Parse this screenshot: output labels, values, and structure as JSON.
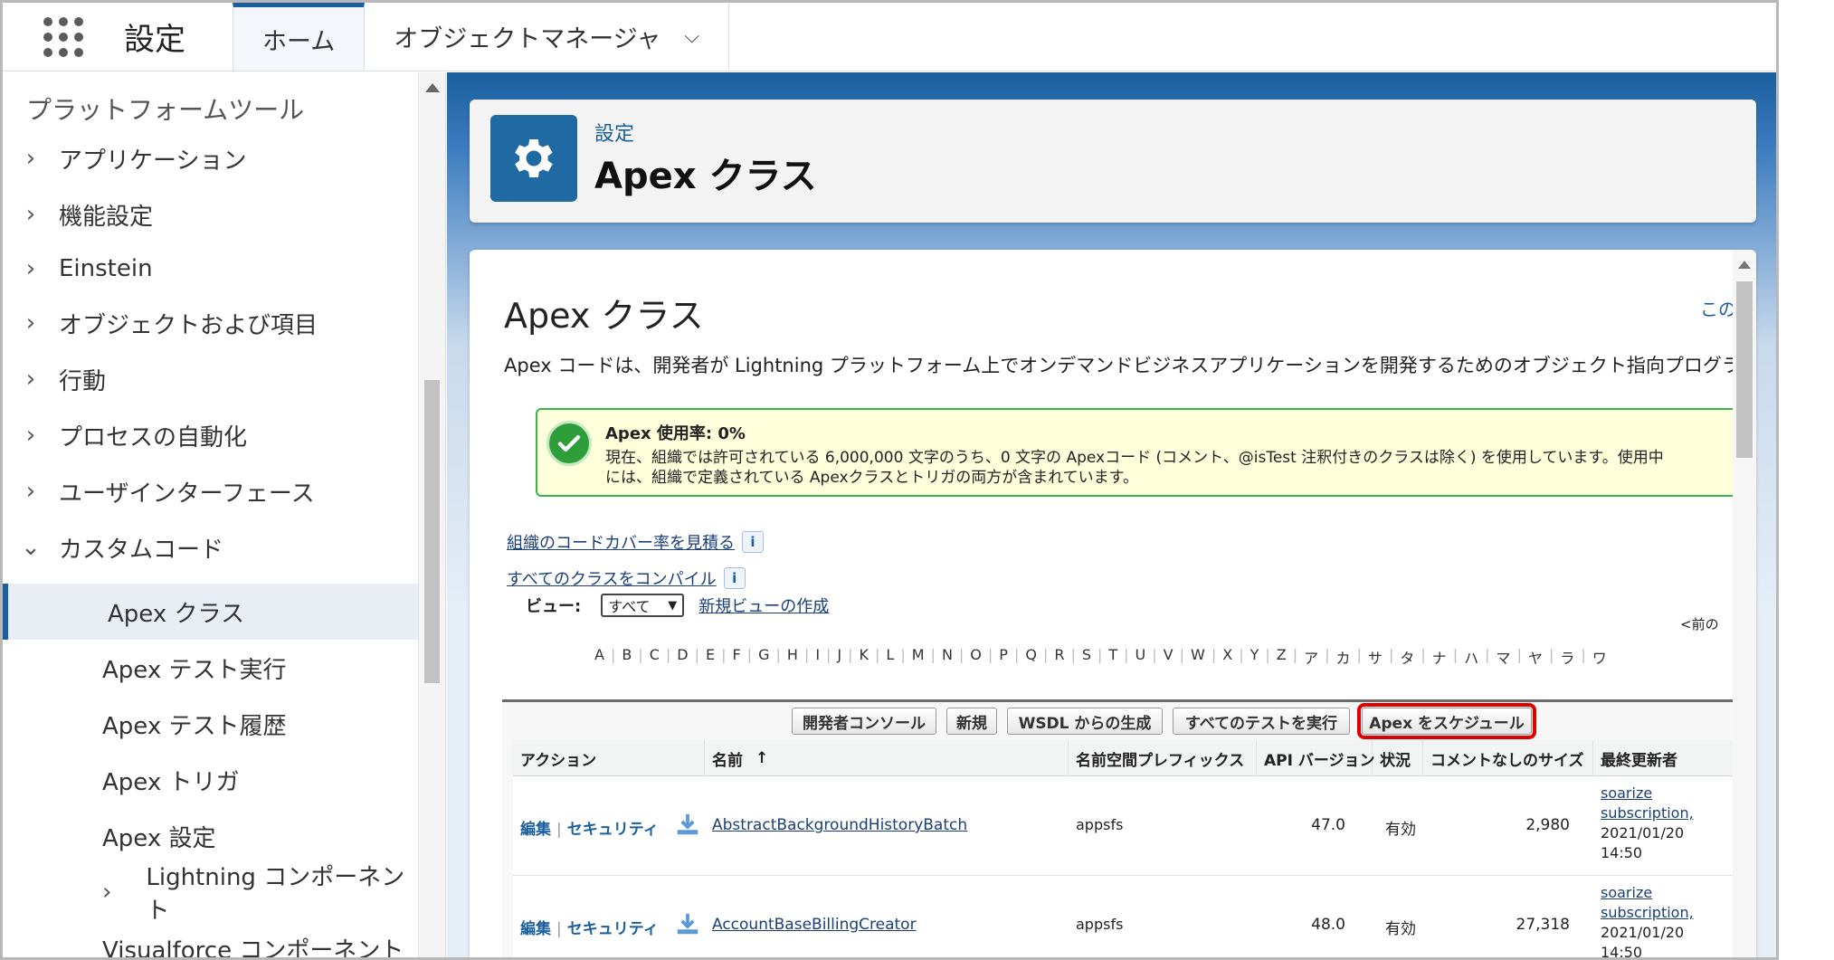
{
  "topbar": {
    "app_title": "設定",
    "tabs": [
      {
        "label": "ホーム",
        "active": true
      },
      {
        "label": "オブジェクトマネージャ",
        "active": false
      }
    ]
  },
  "sidebar": {
    "heading": "プラットフォームツール",
    "items": [
      {
        "label": "アプリケーション",
        "arrow": "›"
      },
      {
        "label": "機能設定",
        "arrow": "›"
      },
      {
        "label": "Einstein",
        "arrow": "›"
      },
      {
        "label": "オブジェクトおよび項目",
        "arrow": "›"
      },
      {
        "label": "行動",
        "arrow": "›"
      },
      {
        "label": "プロセスの自動化",
        "arrow": "›"
      },
      {
        "label": "ユーザインターフェース",
        "arrow": "›"
      },
      {
        "label": "カスタムコード",
        "arrow": "⌄"
      }
    ],
    "children": [
      {
        "label": "Apex クラス",
        "selected": true
      },
      {
        "label": "Apex テスト実行"
      },
      {
        "label": "Apex テスト履歴"
      },
      {
        "label": "Apex トリガ"
      },
      {
        "label": "Apex 設定"
      },
      {
        "label": "Lightning コンポーネント",
        "arrow": "›"
      },
      {
        "label": "Visualforce コンポーネント"
      }
    ]
  },
  "header": {
    "breadcrumb": "設定",
    "title": "Apex クラス"
  },
  "content": {
    "title": "Apex クラス",
    "help_link": "この",
    "description": "Apex コードは、開発者が Lightning プラットフォーム上でオンデマンドビジネスアプリケーションを開発するためのオブジェクト指向プログラミング言語です",
    "alert": {
      "title": "Apex 使用率: 0%",
      "line1": "現在、組織では許可されている 6,000,000 文字のうち、0 文字の Apexコード (コメント、@isTest 注釈付きのクラスは除く) を使用しています。使用中",
      "line2": "には、組織で定義されている Apexクラスとトリガの両方が含まれています。"
    },
    "links": {
      "coverage": "組織のコードカバー率を見積る",
      "compile": "すべてのクラスをコンパイル",
      "info": "i"
    },
    "view": {
      "label": "ビュー:",
      "selected": "すべて",
      "new_view": "新規ビューの作成"
    },
    "prev": "<前の",
    "alphabet": [
      "A",
      "B",
      "C",
      "D",
      "E",
      "F",
      "G",
      "H",
      "I",
      "J",
      "K",
      "L",
      "M",
      "N",
      "O",
      "P",
      "Q",
      "R",
      "S",
      "T",
      "U",
      "V",
      "W",
      "X",
      "Y",
      "Z",
      "ア",
      "カ",
      "サ",
      "タ",
      "ナ",
      "ハ",
      "マ",
      "ヤ",
      "ラ",
      "ワ"
    ],
    "buttons": {
      "dev_console": "開発者コンソール",
      "new": "新規",
      "wsdl": "WSDL からの生成",
      "run_all_tests": "すべてのテストを実行",
      "schedule_apex": "Apex をスケジュール"
    },
    "table": {
      "headers": {
        "action": "アクション",
        "name": "名前",
        "sort": "↑",
        "namespace": "名前空間プレフィックス",
        "api_version": "API バージョン",
        "status": "状況",
        "size": "コメントなしのサイズ",
        "modified_by": "最終更新者"
      },
      "rows": [
        {
          "edit": "編集",
          "security": "セキュリティ",
          "name": "AbstractBackgroundHistoryBatch",
          "namespace": "appsfs",
          "api_version": "47.0",
          "status": "有効",
          "size": "2,980",
          "modified_by_user": "soarize",
          "modified_by_line2": "subscription,",
          "modified_date": "2021/01/20",
          "modified_time": "14:50"
        },
        {
          "edit": "編集",
          "security": "セキュリティ",
          "name": "AccountBaseBillingCreator",
          "namespace": "appsfs",
          "api_version": "48.0",
          "status": "有効",
          "size": "27,318",
          "modified_by_user": "soarize",
          "modified_by_line2": "subscription,",
          "modified_date": "2021/01/20",
          "modified_time": "14:50"
        }
      ]
    }
  },
  "colors": {
    "brand": "#1b5f9e",
    "highlight": "#e00000",
    "alert_bg": "#ffffdc",
    "alert_border": "#39b54a"
  }
}
